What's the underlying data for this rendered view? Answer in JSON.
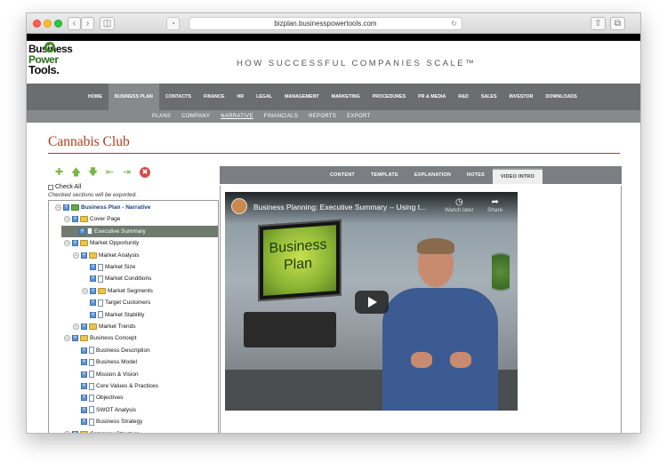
{
  "browser": {
    "url": "bizplan.businesspowertools.com"
  },
  "site": {
    "logo_line1": "Business",
    "logo_line2": "Power",
    "logo_line3": "Tools.",
    "tagline": "HOW SUCCESSFUL COMPANIES SCALE™"
  },
  "mainnav": [
    "HOME",
    "BUSINESS PLAN",
    "CONTACTS",
    "FINANCE",
    "HR",
    "LEGAL",
    "MANAGEMENT",
    "MARKETING",
    "PROCEDURES",
    "PR & MEDIA",
    "R&D",
    "SALES",
    "INVESTOR",
    "DOWNLOADS"
  ],
  "mainnav_active": "BUSINESS PLAN",
  "subnav": [
    "PLANS",
    "COMPANY",
    "NARRATIVE",
    "FINANCIALS",
    "REPORTS",
    "EXPORT"
  ],
  "subnav_active": "NARRATIVE",
  "page": {
    "title": "Cannabis Club",
    "check_all": "Check All",
    "check_note": "Checked sections will be exported."
  },
  "tree": [
    {
      "label": "Business Plan - Narrative",
      "level": 0,
      "bold": true
    },
    {
      "label": "Cover Page",
      "level": 1
    },
    {
      "label": "Executive Summary",
      "level": 1,
      "selected": true
    },
    {
      "label": "Market Opportunity",
      "level": 1
    },
    {
      "label": "Market Analysis",
      "level": 2
    },
    {
      "label": "Market Size",
      "level": 3
    },
    {
      "label": "Market Conditions",
      "level": 3
    },
    {
      "label": "Market Segments",
      "level": 3
    },
    {
      "label": "Target Customers",
      "level": 3
    },
    {
      "label": "Market Stability",
      "level": 3
    },
    {
      "label": "Market Trends",
      "level": 2
    },
    {
      "label": "Business Concept",
      "level": 1
    },
    {
      "label": "Business Description",
      "level": 2
    },
    {
      "label": "Business Model",
      "level": 2
    },
    {
      "label": "Mission & Vision",
      "level": 2
    },
    {
      "label": "Core Values & Practices",
      "level": 2
    },
    {
      "label": "Objectives",
      "level": 2
    },
    {
      "label": "SWOT Analysis",
      "level": 2
    },
    {
      "label": "Business Strategy",
      "level": 2
    },
    {
      "label": "Company Structure",
      "level": 1
    }
  ],
  "tabs": [
    "CONTENT",
    "TEMPLATE",
    "EXPLANATION",
    "NOTES",
    "VIDEO INTRO"
  ],
  "tab_active": "VIDEO INTRO",
  "video": {
    "title": "Business Planning: Executive Summary -- Using t...",
    "watch_later": "Watch later",
    "share": "Share",
    "board_text": "Business Plan"
  }
}
